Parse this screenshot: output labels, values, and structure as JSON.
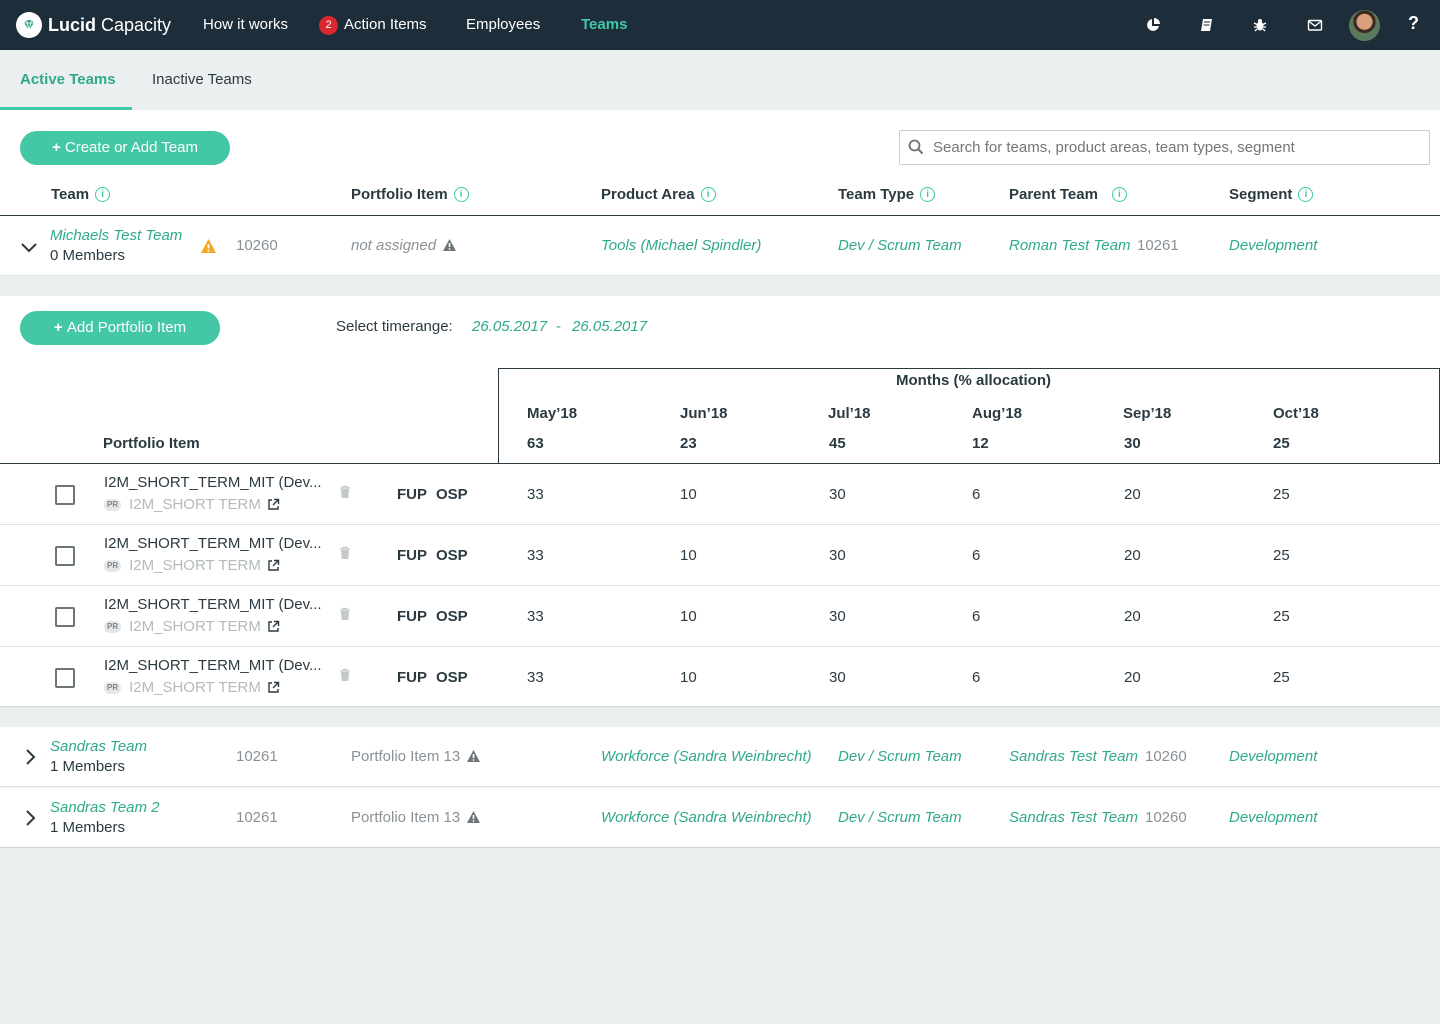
{
  "app": {
    "brand_bold": "Lucid",
    "brand_light": " Capacity"
  },
  "nav": {
    "how_it_works": "How it works",
    "action_items": "Action Items",
    "action_items_count": "2",
    "employees": "Employees",
    "teams": "Teams"
  },
  "tabs": {
    "active": "Active Teams",
    "inactive": "Inactive Teams"
  },
  "toolbar": {
    "create_label": "Create or Add Team",
    "search_placeholder": "Search for teams, product areas, team types, segment"
  },
  "columns": {
    "team": "Team",
    "portfolio_item": "Portfolio Item",
    "product_area": "Product Area",
    "team_type": "Team Type",
    "parent_team": "Parent Team",
    "segment": "Segment"
  },
  "teams": [
    {
      "name": "Michaels Test Team",
      "members": "0 Members",
      "id": "10260",
      "portfolio": "not assigned",
      "product_area": "Tools (Michael Spindler)",
      "team_type": "Dev / Scrum Team",
      "parent_team": "Roman Test Team",
      "parent_id": "10261",
      "segment": "Development"
    },
    {
      "name": "Sandras Team",
      "members": "1 Members",
      "id": "10261",
      "portfolio": "Portfolio Item 13",
      "product_area": "Workforce (Sandra Weinbrecht)",
      "team_type": "Dev / Scrum Team",
      "parent_team": "Sandras Test Team",
      "parent_id": "10260",
      "segment": "Development"
    },
    {
      "name": "Sandras Team 2",
      "members": "1 Members",
      "id": "10261",
      "portfolio": "Portfolio Item 13",
      "product_area": "Workforce (Sandra Weinbrecht)",
      "team_type": "Dev / Scrum Team",
      "parent_team": "Sandras Test Team",
      "parent_id": "10260",
      "segment": "Development"
    }
  ],
  "expanded": {
    "add_portfolio_label": "Add Portfolio Item",
    "timerange_label": "Select timerange:",
    "date_from": "26.05.2017",
    "date_sep": "-",
    "date_to": "26.05.2017",
    "months_title": "Months (% allocation)",
    "portfolio_header": "Portfolio Item",
    "months": [
      {
        "label": "May’18",
        "total": "63"
      },
      {
        "label": "Jun’18",
        "total": "23"
      },
      {
        "label": "Jul’18",
        "total": "45"
      },
      {
        "label": "Aug’18",
        "total": "12"
      },
      {
        "label": "Sep’18",
        "total": "30"
      },
      {
        "label": "Oct’18",
        "total": "25"
      }
    ],
    "rows": [
      {
        "name": "I2M_SHORT_TERM_MIT (Dev...",
        "tag": "PR",
        "sub": "I2M_SHORT TERM",
        "fup": "FUP",
        "osp": "OSP",
        "values": [
          "33",
          "10",
          "30",
          "6",
          "20",
          "25"
        ]
      },
      {
        "name": "I2M_SHORT_TERM_MIT (Dev...",
        "tag": "PR",
        "sub": "I2M_SHORT TERM",
        "fup": "FUP",
        "osp": "OSP",
        "values": [
          "33",
          "10",
          "30",
          "6",
          "20",
          "25"
        ]
      },
      {
        "name": "I2M_SHORT_TERM_MIT (Dev...",
        "tag": "PR",
        "sub": "I2M_SHORT TERM",
        "fup": "FUP",
        "osp": "OSP",
        "values": [
          "33",
          "10",
          "30",
          "6",
          "20",
          "25"
        ]
      },
      {
        "name": "I2M_SHORT_TERM_MIT (Dev...",
        "tag": "PR",
        "sub": "I2M_SHORT TERM",
        "fup": "FUP",
        "osp": "OSP",
        "values": [
          "33",
          "10",
          "30",
          "6",
          "20",
          "25"
        ]
      }
    ]
  },
  "icons": {
    "logo": "gem-logo-icon",
    "reports": "pie-chart-icon",
    "docs": "book-icon",
    "bug": "bug-icon",
    "mail": "mail-icon",
    "help": "?",
    "warning_color": "#f5a623",
    "accent": "#3ec9a7"
  }
}
